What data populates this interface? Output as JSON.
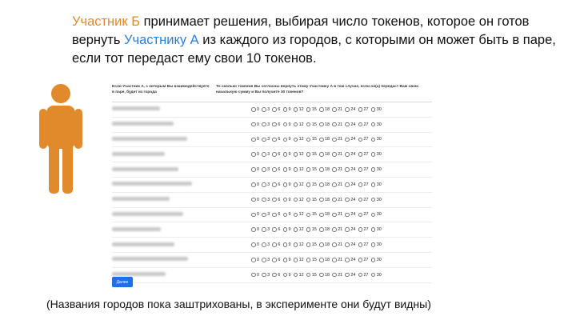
{
  "heading": {
    "part1": "Участник Б",
    "part2": " принимает решения, выбирая число токенов, которое он готов вернуть ",
    "part3": "Участнику А",
    "part4": " из каждого из городов, с которыми он может быть в паре, если тот передаст ему свои 10 токенов."
  },
  "survey": {
    "col1_header": "Если Участник А, с которым Вы взаимодействуете в паре, будет из города",
    "col2_header": "То сколько токенов Вы согласны вернуть этому Участнику А в том случае, если он(а) передаст Вам свою начальную сумму и Вы получите 30 токенов?",
    "options": [
      "0",
      "3",
      "6",
      "9",
      "12",
      "15",
      "18",
      "21",
      "24",
      "27",
      "30"
    ],
    "row_count": 12
  },
  "next_button": {
    "label": "Далее"
  },
  "footnote": "(Названия городов пока заштрихованы, в эксперименте они будут видны)",
  "colors": {
    "accent_orange": "#e08a2b",
    "accent_blue": "#2b7fd9",
    "button_blue": "#1f6fe5"
  }
}
